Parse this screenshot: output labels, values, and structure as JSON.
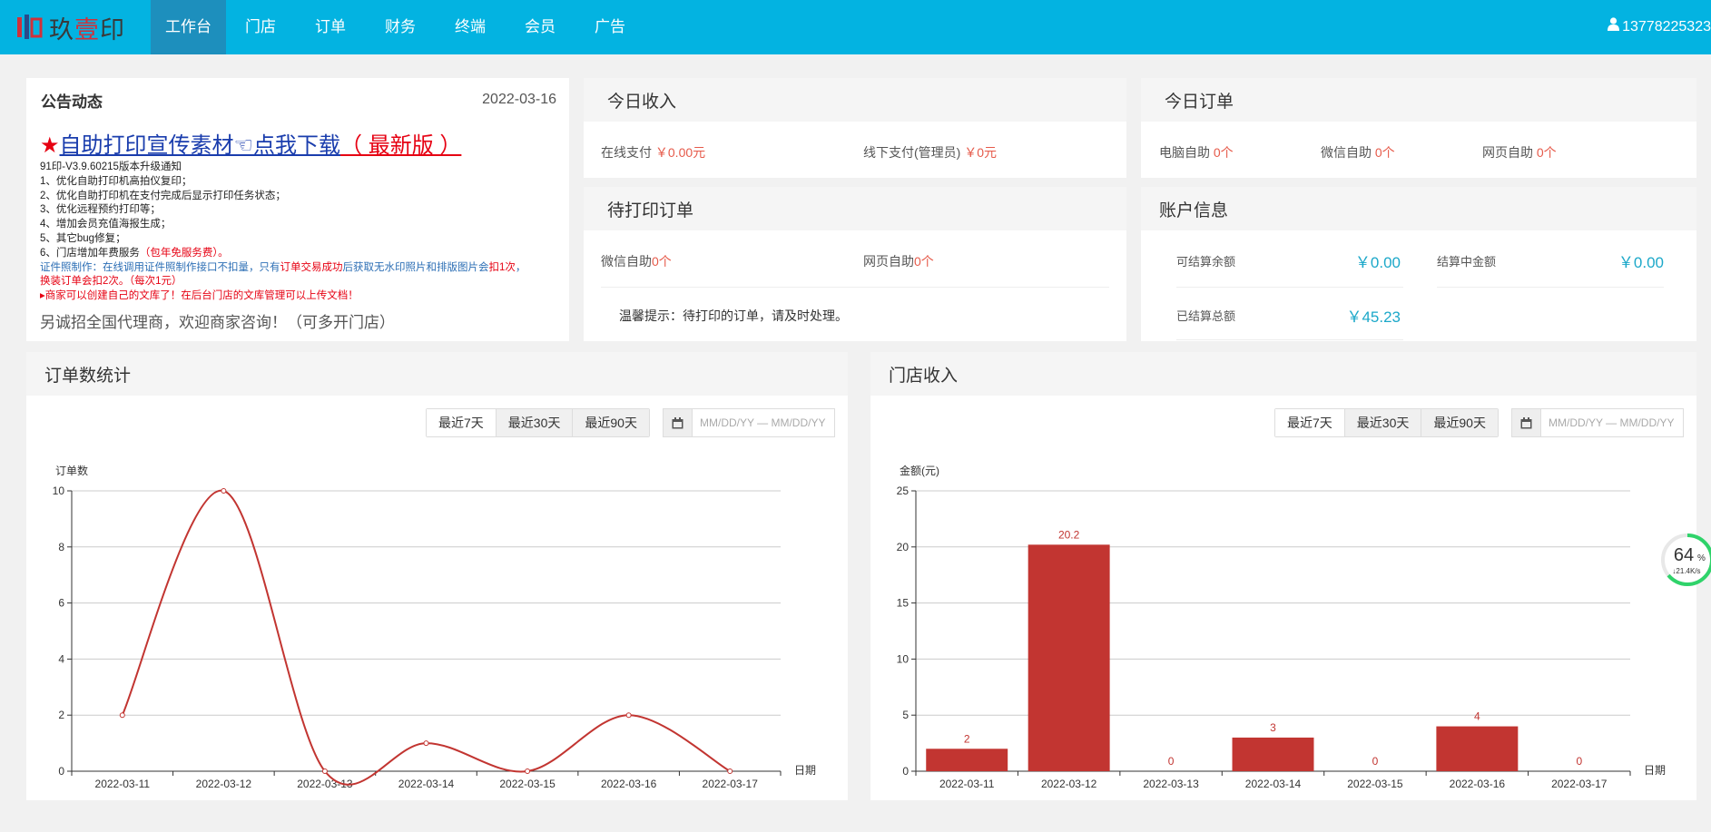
{
  "brand": {
    "logo_text_a": "玖",
    "logo_text_b": "壹",
    "logo_text_c": "印"
  },
  "nav": {
    "items": [
      {
        "label": "工作台",
        "active": true
      },
      {
        "label": "门店"
      },
      {
        "label": "订单"
      },
      {
        "label": "财务"
      },
      {
        "label": "终端"
      },
      {
        "label": "会员"
      },
      {
        "label": "广告"
      }
    ],
    "user": "13778225323"
  },
  "announcement": {
    "title": "公告动态",
    "date": "2022-03-16",
    "link_star": "★",
    "link_text": "自助打印宣传素材☜点我下载",
    "link_tail": "（ 最新版 ）",
    "lines": [
      "91印-V3.9.60215版本升级通知",
      "1、优化自助打印机高拍仪复印；",
      "2、优化自助打印机在支付完成后显示打印任务状态；",
      "3、优化远程预约打印等；",
      "4、增加会员充值海报生成；",
      "5、其它bug修复；"
    ],
    "line6_a": "6、门店增加年费服务",
    "line6_b": "（包年免服务费）。",
    "photo_a": "证件照制作：在线调用证件照制作接口不扣量，只有",
    "photo_b": "订单交易成功",
    "photo_c": "后获取无水印照片和排版图片会",
    "photo_d": "扣1次",
    "photo_e": "，",
    "photo_f": "换装订单会扣2次。（每次1元）",
    "library_note": "▸商家可以创建自己的文库了！在后台门店的文库管理可以上传文档！",
    "footer": "另诚招全国代理商，欢迎商家咨询！（可多开门店）"
  },
  "today_income": {
    "title": "今日收入",
    "online_label": "在线支付",
    "online_value": "￥0.00元",
    "offline_label": "线下支付(管理员)",
    "offline_value": "￥0元"
  },
  "today_orders": {
    "title": "今日订单",
    "items": [
      {
        "label": "电脑自助",
        "value": "0个"
      },
      {
        "label": "微信自助",
        "value": "0个"
      },
      {
        "label": "网页自助",
        "value": "0个"
      }
    ]
  },
  "pending_print": {
    "title": "待打印订单",
    "wechat_label": "微信自助",
    "wechat_value": "0个",
    "web_label": "网页自助",
    "web_value": "0个",
    "tip": "温馨提示：待打印的订单，请及时处理。"
  },
  "account": {
    "title": "账户信息",
    "settleable_label": "可结算余额",
    "settleable_value": "￥0.00",
    "settling_label": "结算中金额",
    "settling_value": "￥0.00",
    "settled_label": "已结算总额",
    "settled_value": "￥45.23"
  },
  "controls": {
    "ranges": [
      "最近7天",
      "最近30天",
      "最近90天"
    ],
    "date_placeholder": "MM/DD/YY — MM/DD/YY"
  },
  "charts": {
    "orders_title": "订单数统计",
    "income_title": "门店收入"
  },
  "speed_widget": {
    "percent": "64",
    "unit": "%",
    "speed": "↓21.4K/s",
    "level": 0.64
  },
  "colors": {
    "topbar": "#03b3e1",
    "series": "#c23531",
    "accent": "#1ca8c9",
    "red_text": "#e65a4a"
  },
  "chart_data": [
    {
      "type": "line",
      "title": "",
      "ylabel": "订单数",
      "xlabel": "日期",
      "categories": [
        "2022-03-11",
        "2022-03-12",
        "2022-03-13",
        "2022-03-14",
        "2022-03-15",
        "2022-03-16",
        "2022-03-17"
      ],
      "series": [
        {
          "values": [
            2,
            10,
            0,
            1,
            0,
            2,
            0
          ]
        }
      ],
      "ylim": [
        0,
        10
      ],
      "yticks": [
        0,
        2,
        4,
        6,
        8,
        10
      ],
      "smooth": true,
      "grid": true
    },
    {
      "type": "bar",
      "title": "",
      "ylabel": "金额(元)",
      "xlabel": "日期",
      "categories": [
        "2022-03-11",
        "2022-03-12",
        "2022-03-13",
        "2022-03-14",
        "2022-03-15",
        "2022-03-16",
        "2022-03-17"
      ],
      "series": [
        {
          "values": [
            2,
            20.2,
            0,
            3,
            0,
            4,
            0
          ]
        }
      ],
      "data_labels": [
        "2",
        "20.2",
        "0",
        "3",
        "0",
        "4",
        "0"
      ],
      "ylim": [
        0,
        25
      ],
      "yticks": [
        0,
        5,
        10,
        15,
        20,
        25
      ],
      "grid": true
    }
  ]
}
